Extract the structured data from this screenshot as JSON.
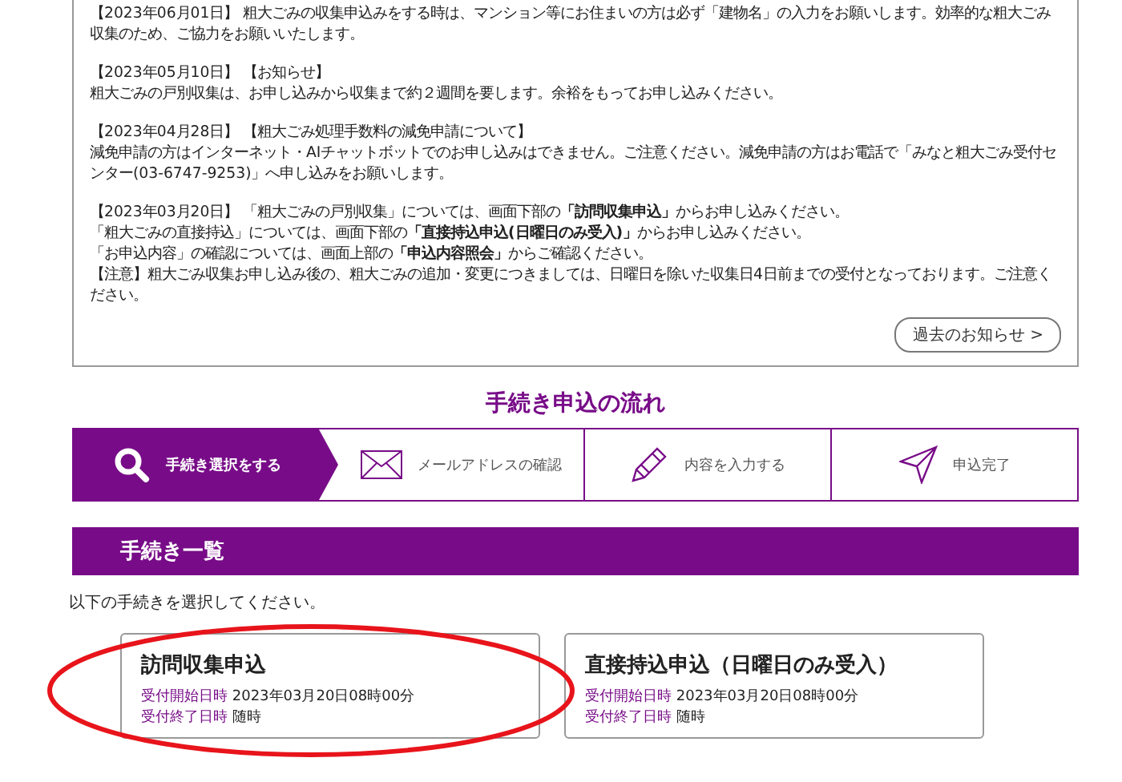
{
  "notices": [
    {
      "lines": [
        "【2023年06月01日】 粗大ごみの収集申込みをする時は、マンション等にお住まいの方は必ず「建物名」の入力をお願いします。効率的な粗大ごみ収集のため、ご協力をお願いいたします。"
      ]
    },
    {
      "lines": [
        "【2023年05月10日】 【お知らせ】",
        "粗大ごみの戸別収集は、お申し込みから収集まで約２週間を要します。余裕をもってお申し込みください。"
      ]
    },
    {
      "lines": [
        "【2023年04月28日】 【粗大ごみ処理手数料の減免申請について】",
        "減免申請の方はインターネット・AIチャットボットでのお申し込みはできません。ご注意ください。減免申請の方はお電話で「みなと粗大ごみ受付センター(03-6747-9253)」へ申し込みをお願いします。"
      ]
    },
    {
      "lines": [
        "【2023年03月20日】 「粗大ごみの戸別収集」については、画面下部の**「訪問収集申込」**からお申し込みください。",
        "「粗大ごみの直接持込」については、画面下部の**「直接持込申込(日曜日のみ受入)」**からお申し込みください。",
        "「お申込内容」の確認については、画面上部の**「申込内容照会」**からご確認ください。",
        "【注意】粗大ごみ収集お申し込み後の、粗大ごみの追加・変更につきましては、日曜日を除いた収集日4日前までの受付となっております。ご注意ください。"
      ]
    }
  ],
  "past_notices_button": "過去のお知らせ >",
  "flow": {
    "title": "手続き申込の流れ",
    "steps": [
      {
        "kind": "search",
        "label": "手続き選択をする",
        "selected": true
      },
      {
        "kind": "mail",
        "label": "メールアドレスの確認",
        "selected": false
      },
      {
        "kind": "pencil",
        "label": "内容を入力する",
        "selected": false
      },
      {
        "kind": "send",
        "label": "申込完了",
        "selected": false
      }
    ]
  },
  "procedures": {
    "title": "手続き一覧",
    "instruction": "以下の手続きを選択してください。",
    "cards": [
      {
        "title": "訪問収集申込",
        "start_label": "受付開始日時",
        "start": "2023年03月20日08時00分",
        "end_label": "受付終了日時",
        "end": "随時",
        "highlighted": true
      },
      {
        "title": "直接持込申込（日曜日のみ受入）",
        "start_label": "受付開始日時",
        "start": "2023年03月20日08時00分",
        "end_label": "受付終了日時",
        "end": "随時",
        "highlighted": false
      }
    ]
  }
}
